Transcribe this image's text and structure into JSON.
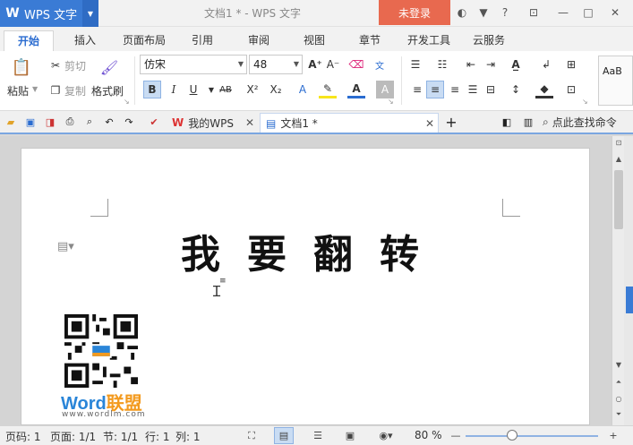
{
  "titlebar": {
    "app_logo": "W",
    "app_name": "WPS 文字",
    "doc_title": "文档1 * - WPS 文字",
    "login": "未登录",
    "icons": [
      "skin-icon",
      "shirt-icon",
      "help-icon",
      "minimize-icon",
      "restore-icon",
      "maximize-icon",
      "close-icon"
    ]
  },
  "ribbon_tabs": [
    "开始",
    "插入",
    "页面布局",
    "引用",
    "审阅",
    "视图",
    "章节",
    "开发工具",
    "云服务"
  ],
  "clipboard": {
    "paste": "粘贴",
    "cut": "剪切",
    "copy": "复制",
    "format_painter": "格式刷"
  },
  "font": {
    "family": "仿宋",
    "size": "48"
  },
  "styles_preview": "AaB",
  "doc_tabs": {
    "home_tab": "我的WPS",
    "doc_tab": "文档1 *",
    "find_command": "点此查找命令"
  },
  "document": {
    "heading": "我要翻转",
    "brand_word": "Word",
    "brand_cn": "联盟",
    "brand_url": "www.wordlm.com"
  },
  "status": {
    "page_no": "页码: 1",
    "page": "页面: 1/1",
    "section": "节: 1/1",
    "row": "行: 1",
    "col": "列: 1",
    "zoom": "80 %"
  },
  "colors": {
    "accent": "#3a7bd5",
    "login": "#e8694f",
    "brand_blue": "#2a85d8",
    "brand_orange": "#f39a1e"
  }
}
